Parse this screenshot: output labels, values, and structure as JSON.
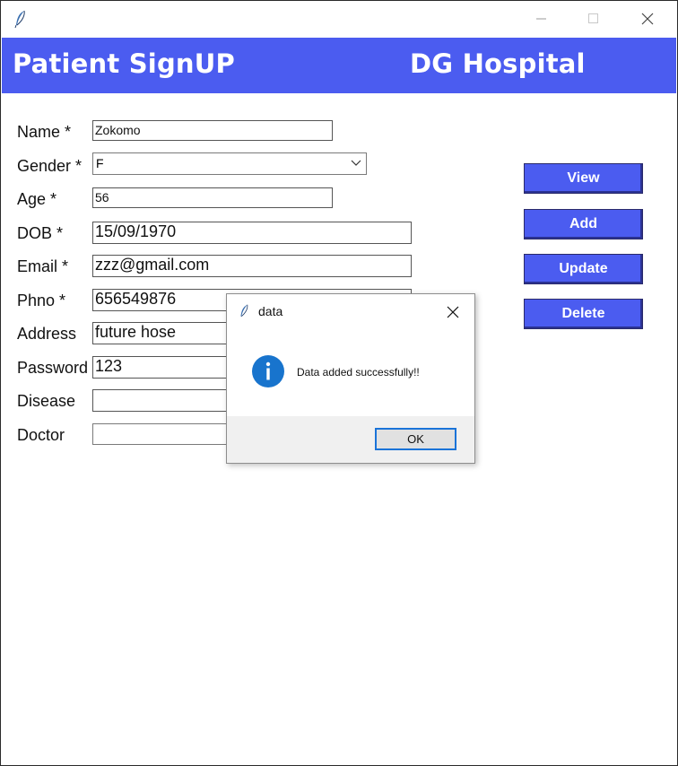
{
  "window": {
    "icon": "feather-icon",
    "controls": [
      "minimize-icon",
      "maximize-icon",
      "close-icon"
    ]
  },
  "header": {
    "title": "Patient SignUP",
    "hospital": "DG Hospital",
    "background": "#4b5cf0"
  },
  "form": {
    "name_label": "Name *",
    "name_value": "Zokomo",
    "gender_label": "Gender *",
    "gender_value": "F",
    "age_label": "Age *",
    "age_value": "56",
    "dob_label": "DOB *",
    "dob_value": "15/09/1970",
    "email_label": "Email *",
    "email_value": "zzz@gmail.com",
    "phno_label": "Phno *",
    "phno_value": "656549876",
    "address_label": "Address",
    "address_value": "future hose",
    "password_label": "Password",
    "password_value": "123",
    "disease_label": "Disease",
    "disease_value": "",
    "doctor_label": "Doctor",
    "doctor_value": ""
  },
  "actions": {
    "view": "View",
    "add": "Add",
    "update": "Update",
    "delete": "Delete"
  },
  "dialog": {
    "title": "data",
    "message": "Data added successfully!!",
    "ok": "OK",
    "icon": "info-icon"
  }
}
